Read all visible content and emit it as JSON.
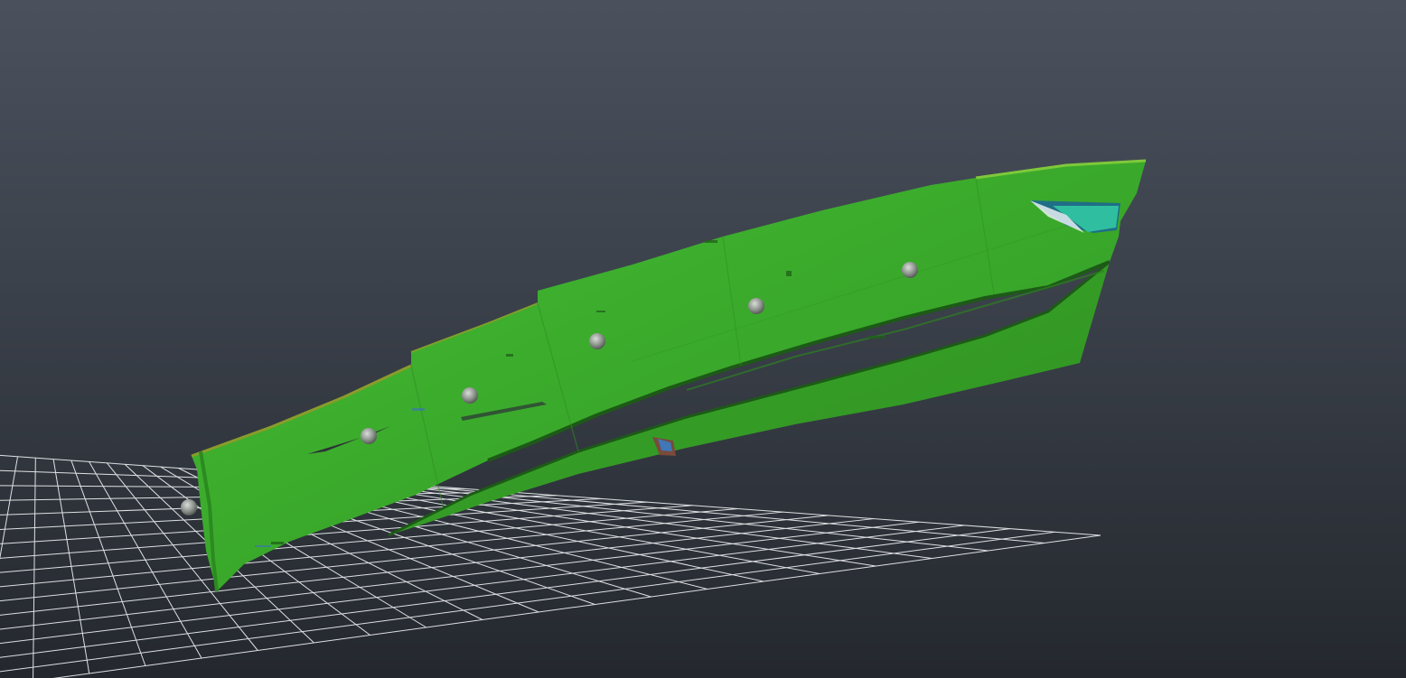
{
  "viewport": {
    "background_top_color": "#4a515d",
    "background_bottom_color": "#24282e"
  },
  "grid": {
    "line_color": "#f2f4f6"
  },
  "scan_mesh": {
    "color": "#3cae2c",
    "shadow_color": "#2a7d1e",
    "edge_color": "#1d5a17",
    "cavity_color": "#2fbfa0",
    "cavity_shadow_color": "#1f6e86",
    "marker_count": 6,
    "marker_color": "#9aa09a"
  }
}
